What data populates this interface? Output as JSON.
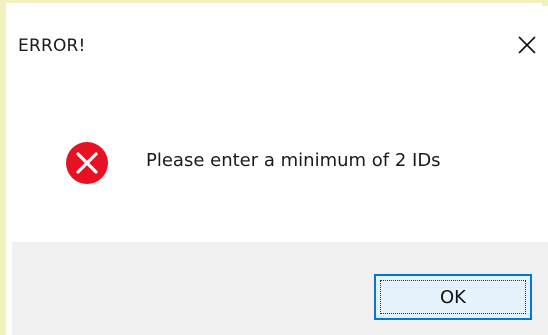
{
  "dialog": {
    "title": "ERROR!",
    "close_icon": "close-icon",
    "message": "Please enter a minimum of 2 IDs",
    "message_icon": "error-icon",
    "ok_label": "OK"
  },
  "colors": {
    "error_red": "#e81123",
    "footer_bg": "#f0f0f0",
    "button_border": "#0078d7",
    "button_bg": "#e5f1fb"
  }
}
